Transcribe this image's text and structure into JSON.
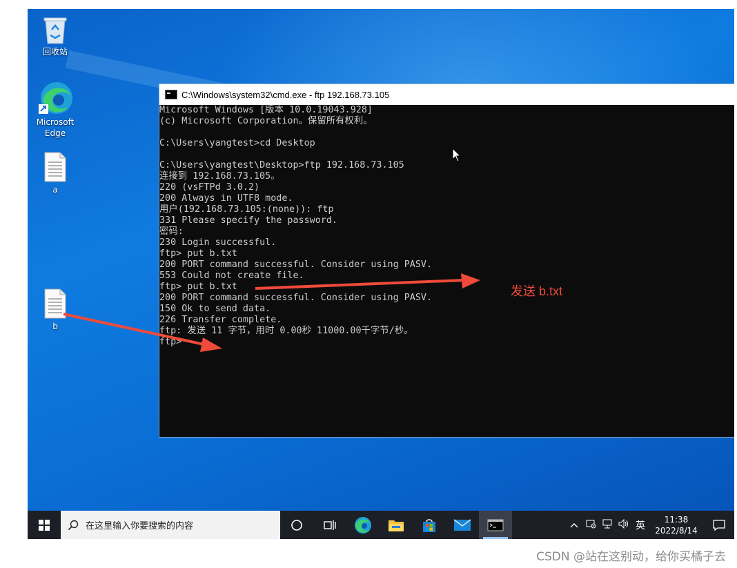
{
  "desktop": {
    "icons": [
      {
        "label": "回收站"
      },
      {
        "label": "Microsoft Edge"
      },
      {
        "label": "a"
      },
      {
        "label": "b"
      }
    ]
  },
  "console_window": {
    "title": "C:\\Windows\\system32\\cmd.exe - ftp  192.168.73.105",
    "lines": [
      "Microsoft Windows [版本 10.0.19043.928]",
      "(c) Microsoft Corporation。保留所有权利。",
      "",
      "C:\\Users\\yangtest>cd Desktop",
      "",
      "C:\\Users\\yangtest\\Desktop>ftp 192.168.73.105",
      "连接到 192.168.73.105。",
      "220 (vsFTPd 3.0.2)",
      "200 Always in UTF8 mode.",
      "用户(192.168.73.105:(none)): ftp",
      "331 Please specify the password.",
      "密码:",
      "230 Login successful.",
      "ftp> put b.txt",
      "200 PORT command successful. Consider using PASV.",
      "553 Could not create file.",
      "ftp> put b.txt",
      "200 PORT command successful. Consider using PASV.",
      "150 Ok to send data.",
      "226 Transfer complete.",
      "ftp: 发送 11 字节，用时 0.00秒 11000.00千字节/秒。",
      "ftp>"
    ]
  },
  "annotation": {
    "text": "发送 b.txt",
    "color": "#f04a3a"
  },
  "taskbar": {
    "search_placeholder": "在这里输入你要搜索的内容",
    "tray": {
      "ime": "英",
      "time": "11:38",
      "date": "2022/8/14"
    }
  },
  "watermark": "CSDN @站在这别动，给你买橘子去"
}
